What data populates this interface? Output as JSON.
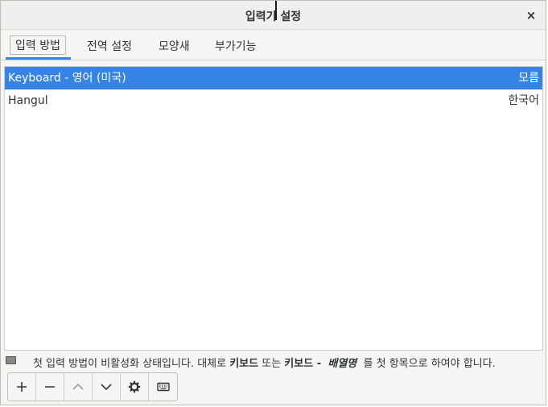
{
  "window": {
    "title": "입력기 설정",
    "close_glyph": "×"
  },
  "tabs": [
    {
      "label": "입력 방법",
      "active": true
    },
    {
      "label": "전역 설정",
      "active": false
    },
    {
      "label": "모양새",
      "active": false
    },
    {
      "label": "부가기능",
      "active": false
    }
  ],
  "input_methods": [
    {
      "name": "Keyboard - 영어 (미국)",
      "language": "모름",
      "selected": true
    },
    {
      "name": "Hangul",
      "language": "한국어",
      "selected": false
    }
  ],
  "message": {
    "icon": "keyboard-status-icon",
    "part1": "첫 입력 방법이 비활성화 상태입니다. 대체로 ",
    "bold1": "키보드",
    "part2": " 또는 ",
    "bold2": "키보드 -",
    "bold_italic": "배열명",
    "part3": " 를 첫 항목으로 하여야 합니다."
  },
  "toolbar": {
    "buttons": [
      {
        "name": "add-button",
        "icon": "plus-icon",
        "enabled": true
      },
      {
        "name": "remove-button",
        "icon": "minus-icon",
        "enabled": true
      },
      {
        "name": "move-up-button",
        "icon": "chevron-up-icon",
        "enabled": false
      },
      {
        "name": "move-down-button",
        "icon": "chevron-down-icon",
        "enabled": true
      },
      {
        "name": "configure-button",
        "icon": "gear-icon",
        "enabled": true
      },
      {
        "name": "keyboard-layout-button",
        "icon": "keyboard-icon",
        "enabled": true
      }
    ]
  },
  "colors": {
    "accent": "#3584e4",
    "selected_text": "#ffffff",
    "text": "#2e3436"
  }
}
